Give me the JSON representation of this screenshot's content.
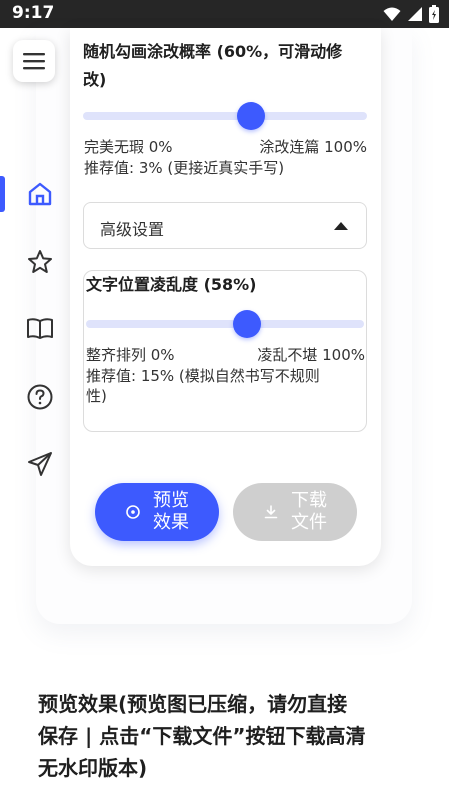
{
  "status_bar": {
    "time": "9:17"
  },
  "nav": {
    "items": [
      {
        "icon": "home-icon",
        "active": true
      },
      {
        "icon": "star-icon",
        "active": false
      },
      {
        "icon": "book-icon",
        "active": false
      },
      {
        "icon": "help-icon",
        "active": false
      },
      {
        "icon": "send-icon",
        "active": false
      }
    ],
    "accent": "#3d5afe"
  },
  "scribble": {
    "title": "随机勾画涂改概率 (60%，可滑动修改)",
    "title_line1": "随机勾画涂改概率 (60%，可滑动修",
    "title_line2": "改)",
    "value_percent": 60,
    "min_label": "完美无瑕 0%",
    "max_label": "涂改连篇 100%",
    "hint": "推荐值: 3% (更接近真实手写)"
  },
  "advanced": {
    "label": "高级设置",
    "expanded": true
  },
  "position": {
    "title": "文字位置凌乱度 (58%)",
    "value_percent": 58,
    "min_label": "整齐排列 0%",
    "max_label": "凌乱不堪 100%",
    "hint_line1": "推荐值: 15% (模拟自然书写不规则",
    "hint_line2": "性)"
  },
  "buttons": {
    "preview_line1": "预览",
    "preview_line2": "效果",
    "download_line1": "下载",
    "download_line2": "文件"
  },
  "footer": {
    "line1": "预览效果(预览图已压缩，请勿直接",
    "line2": "保存 | 点击“下载文件”按钮下载高清",
    "line3": "无水印版本)"
  },
  "colors": {
    "primary": "#3d5afe",
    "track": "#dfe3fb",
    "disabled": "#cfcfcf"
  }
}
